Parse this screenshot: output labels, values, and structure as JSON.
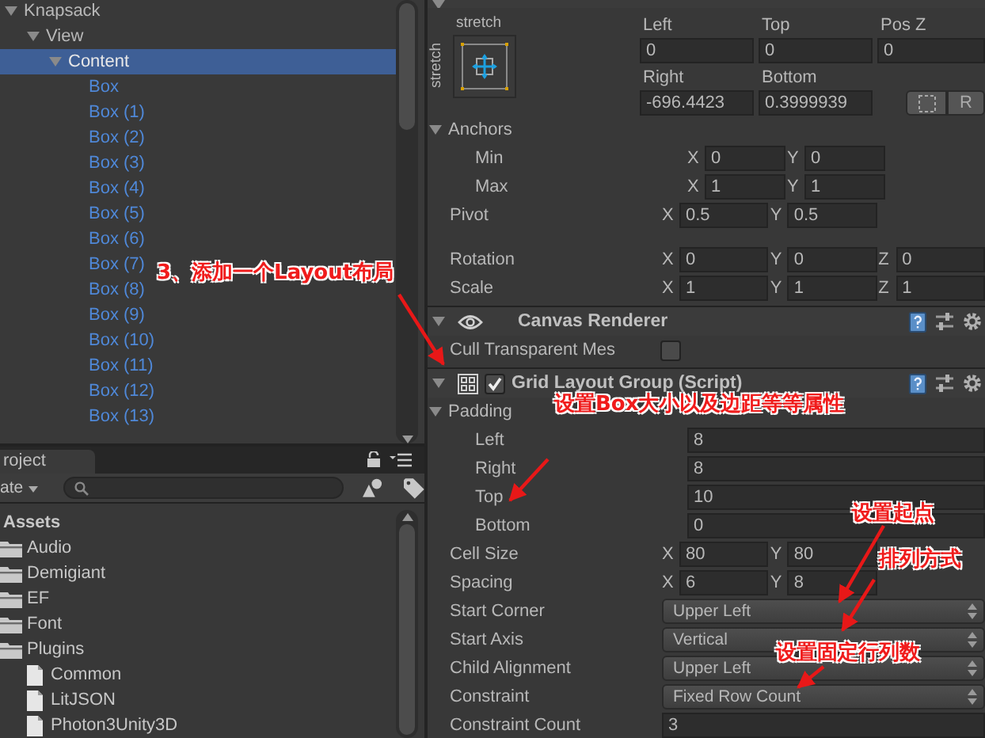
{
  "hierarchy": {
    "items": [
      {
        "label": "Knapsack",
        "kind": "object",
        "selected": false,
        "expanded": true,
        "children": [
          {
            "label": "View",
            "kind": "object",
            "selected": false,
            "expanded": true,
            "children": [
              {
                "label": "Content",
                "kind": "object",
                "selected": true,
                "expanded": true,
                "children": [
                  {
                    "label": "Box",
                    "kind": "prefab",
                    "selected": false
                  },
                  {
                    "label": "Box (1)",
                    "kind": "prefab",
                    "selected": false
                  },
                  {
                    "label": "Box (2)",
                    "kind": "prefab",
                    "selected": false
                  },
                  {
                    "label": "Box (3)",
                    "kind": "prefab",
                    "selected": false
                  },
                  {
                    "label": "Box (4)",
                    "kind": "prefab",
                    "selected": false
                  },
                  {
                    "label": "Box (5)",
                    "kind": "prefab",
                    "selected": false
                  },
                  {
                    "label": "Box (6)",
                    "kind": "prefab",
                    "selected": false
                  },
                  {
                    "label": "Box (7)",
                    "kind": "prefab",
                    "selected": false
                  },
                  {
                    "label": "Box (8)",
                    "kind": "prefab",
                    "selected": false
                  },
                  {
                    "label": "Box (9)",
                    "kind": "prefab",
                    "selected": false
                  },
                  {
                    "label": "Box (10)",
                    "kind": "prefab",
                    "selected": false
                  },
                  {
                    "label": "Box (11)",
                    "kind": "prefab",
                    "selected": false
                  },
                  {
                    "label": "Box (12)",
                    "kind": "prefab",
                    "selected": false
                  },
                  {
                    "label": "Box (13)",
                    "kind": "prefab",
                    "selected": false
                  }
                ]
              }
            ]
          }
        ]
      }
    ]
  },
  "project": {
    "tab": "roject",
    "create_menu": "ate",
    "root": {
      "label": "Assets",
      "children": [
        {
          "label": "Audio",
          "kind": "folder",
          "selected": false
        },
        {
          "label": "Demigiant",
          "kind": "folder",
          "selected": false
        },
        {
          "label": "EF",
          "kind": "folder",
          "selected": false
        },
        {
          "label": "Font",
          "kind": "folder",
          "selected": false
        },
        {
          "label": "Plugins",
          "kind": "folder",
          "selected": false,
          "children": [
            {
              "label": "Common",
              "kind": "file",
              "selected": false
            },
            {
              "label": "LitJSON",
              "kind": "file",
              "selected": false
            },
            {
              "label": "Photon3Unity3D",
              "kind": "file",
              "selected": false
            }
          ]
        }
      ]
    }
  },
  "inspector": {
    "rect_transform": {
      "anchor_preset": {
        "horizontal": "stretch",
        "vertical": "stretch"
      },
      "position_fields": [
        [
          {
            "label": "Left",
            "value": "0"
          },
          {
            "label": "Top",
            "value": "0"
          },
          {
            "label": "Pos Z",
            "value": "0"
          }
        ],
        [
          {
            "label": "Right",
            "value": "-696.4423"
          },
          {
            "label": "Bottom",
            "value": "0.3999939"
          }
        ]
      ],
      "buttons": [
        {
          "kind": "blueprint"
        },
        {
          "kind": "text",
          "label": "R"
        }
      ],
      "properties": [
        {
          "kind": "group",
          "label": "Anchors",
          "expanded": true,
          "children": [
            {
              "kind": "vector",
              "label": "Min",
              "values": [
                {
                  "axis": "X",
                  "value": "0"
                },
                {
                  "axis": "Y",
                  "value": "0"
                }
              ]
            },
            {
              "kind": "vector",
              "label": "Max",
              "values": [
                {
                  "axis": "X",
                  "value": "1"
                },
                {
                  "axis": "Y",
                  "value": "1"
                }
              ]
            }
          ]
        },
        {
          "kind": "vector",
          "label": "Pivot",
          "values": [
            {
              "axis": "X",
              "value": "0.5"
            },
            {
              "axis": "Y",
              "value": "0.5"
            }
          ]
        }
      ],
      "transform": [
        {
          "kind": "vector",
          "label": "Rotation",
          "values": [
            {
              "axis": "X",
              "value": "0"
            },
            {
              "axis": "Y",
              "value": "0"
            },
            {
              "axis": "Z",
              "value": "0"
            }
          ]
        },
        {
          "kind": "vector",
          "label": "Scale",
          "values": [
            {
              "axis": "X",
              "value": "1"
            },
            {
              "axis": "Y",
              "value": "1"
            },
            {
              "axis": "Z",
              "value": "1"
            }
          ]
        }
      ]
    },
    "components": [
      {
        "title": "Canvas Renderer",
        "kind": "renderer",
        "properties": [
          {
            "kind": "checkbox",
            "label": "Cull Transparent Mes",
            "checked": false
          }
        ]
      },
      {
        "title": "Grid Layout Group (Script)",
        "kind": "layout_script",
        "enabled": true,
        "properties": [
          {
            "kind": "group",
            "label": "Padding",
            "expanded": true,
            "children": [
              {
                "kind": "number",
                "label": "Left",
                "value": "8"
              },
              {
                "kind": "number",
                "label": "Right",
                "value": "8"
              },
              {
                "kind": "number",
                "label": "Top",
                "value": "10"
              },
              {
                "kind": "number",
                "label": "Bottom",
                "value": "0"
              }
            ]
          },
          {
            "kind": "vector",
            "label": "Cell Size",
            "values": [
              {
                "axis": "X",
                "value": "80"
              },
              {
                "axis": "Y",
                "value": "80"
              }
            ]
          },
          {
            "kind": "vector",
            "label": "Spacing",
            "values": [
              {
                "axis": "X",
                "value": "6"
              },
              {
                "axis": "Y",
                "value": "8"
              }
            ]
          },
          {
            "kind": "dropdown",
            "label": "Start Corner",
            "value": "Upper Left"
          },
          {
            "kind": "dropdown",
            "label": "Start Axis",
            "value": "Vertical"
          },
          {
            "kind": "dropdown",
            "label": "Child Alignment",
            "value": "Upper Left"
          },
          {
            "kind": "dropdown",
            "label": "Constraint",
            "value": "Fixed Row Count"
          },
          {
            "kind": "number",
            "label": "Constraint Count",
            "value": "3"
          }
        ]
      }
    ]
  },
  "annotations": [
    {
      "text": "3、添加一个Layout布局"
    },
    {
      "text": "设置Box大小以及边距等等属性"
    },
    {
      "text": "设置起点"
    },
    {
      "text": "排列方式"
    },
    {
      "text": "设置固定行列数"
    }
  ]
}
